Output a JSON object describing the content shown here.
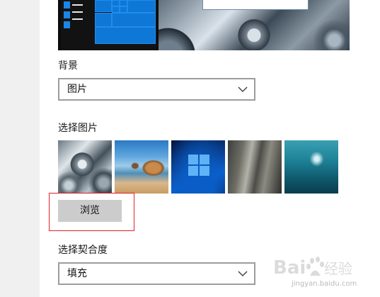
{
  "preview": {
    "start_menu": {
      "icon": "hamburger-menu-icon"
    },
    "tiles_color": "#0f78d7",
    "wallpaper": "metal gears"
  },
  "background": {
    "label": "背景",
    "dropdown_value": "图片"
  },
  "choose_picture": {
    "label": "选择图片",
    "thumbnails": [
      {
        "name": "metal-gears"
      },
      {
        "name": "beach-arch-rock"
      },
      {
        "name": "windows-10-light"
      },
      {
        "name": "rock-cliff"
      },
      {
        "name": "underwater-swimmer"
      }
    ]
  },
  "browse_button": {
    "label": "浏览"
  },
  "fit": {
    "label": "选择契合度",
    "dropdown_value": "填充"
  },
  "watermark": {
    "logo_text": "Baidu经验",
    "url": "jingyan.baidu.com"
  },
  "colors": {
    "highlight_border": "#e0222a",
    "button_bg": "#cccccc",
    "dropdown_border": "#9d9d9d"
  }
}
